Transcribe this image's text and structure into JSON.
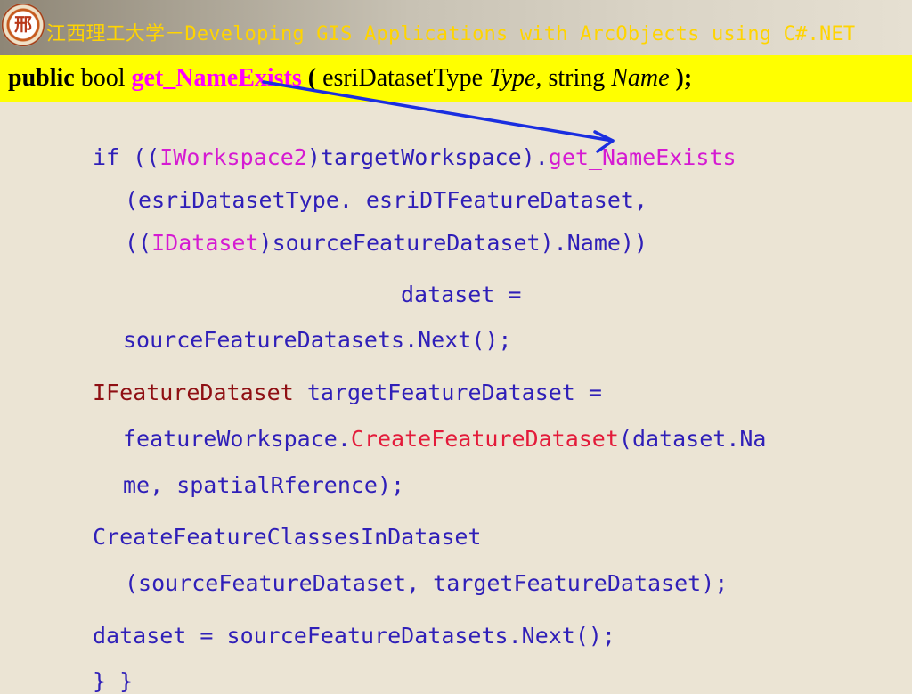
{
  "header": {
    "logo_text": "邢",
    "title": "江西理工大学－Developing GIS Applications with ArcObjects using C#.NET"
  },
  "signature": {
    "public": "public",
    "bool": " bool ",
    "method": "get_NameExists",
    "open": " ( ",
    "type1": "esriDatasetType ",
    "param1": "Type,",
    "space": "   string ",
    "param2": "Name",
    "close": " );"
  },
  "code": {
    "line1": {
      "a": "if ((",
      "b": "IWorkspace2",
      "c": ")targetWorkspace).",
      "d": "get_NameExists"
    },
    "line2": "(esriDatasetType. esriDTFeatureDataset,",
    "line3": {
      "a": "((",
      "b": "IDataset",
      "c": ")sourceFeatureDataset).Name))"
    },
    "line4": "dataset =",
    "line5": "sourceFeatureDatasets.Next();",
    "line6": {
      "a": "IFeatureDataset",
      "b": " targetFeatureDataset ="
    },
    "line7": {
      "a": "featureWorkspace.",
      "b": "CreateFeatureDataset",
      "c": "(dataset.Na"
    },
    "line8": "me, spatialRference);",
    "line9": "CreateFeatureClassesInDataset",
    "line10": "(sourceFeatureDataset, targetFeatureDataset);",
    "line11": "dataset = sourceFeatureDatasets.Next();",
    "line12": "}      }"
  },
  "colors": {
    "background": "#ebe4d4",
    "header_text": "#ffd400",
    "signature_bar": "#ffff00",
    "code_blue": "#2f1fb8",
    "magenta": "#d51ad2",
    "dark_red": "#8f0f13",
    "red": "#e31b3a",
    "arrow": "#1a2ee0"
  }
}
